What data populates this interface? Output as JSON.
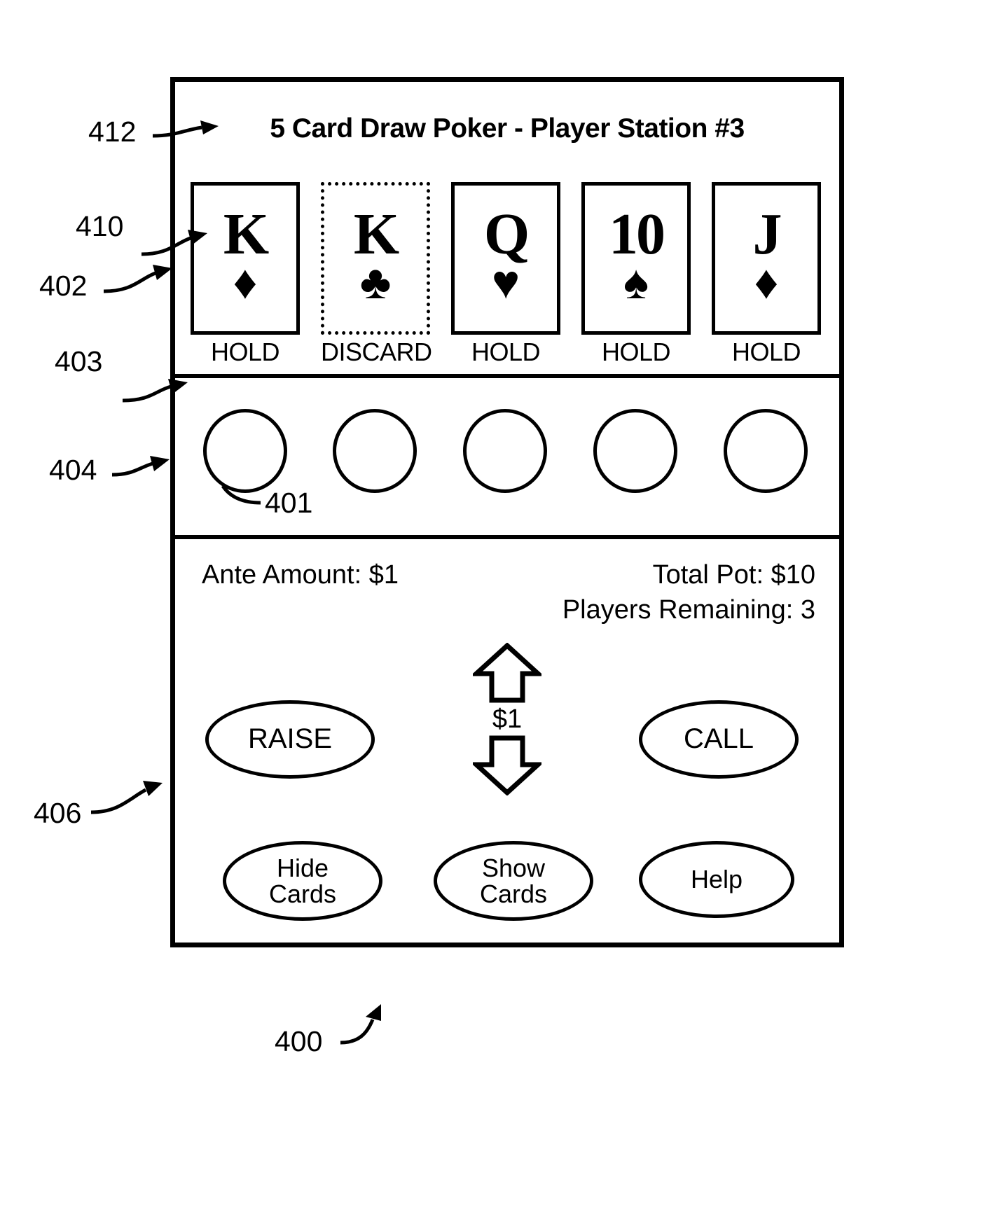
{
  "figure": {
    "number": "400",
    "title": "5 Card Draw Poker - Player Station #3"
  },
  "reference_labels": [
    {
      "id": "412",
      "text": "412"
    },
    {
      "id": "410",
      "text": "410"
    },
    {
      "id": "402",
      "text": "402"
    },
    {
      "id": "403",
      "text": "403"
    },
    {
      "id": "404",
      "text": "404"
    },
    {
      "id": "401",
      "text": "401"
    },
    {
      "id": "406",
      "text": "406"
    },
    {
      "id": "400",
      "text": "400"
    }
  ],
  "cards": [
    {
      "rank": "K",
      "suit": "diamond",
      "suit_glyph": "♦",
      "action": "HOLD",
      "selected": false
    },
    {
      "rank": "K",
      "suit": "club",
      "suit_glyph": "♣",
      "action": "DISCARD",
      "selected": true
    },
    {
      "rank": "Q",
      "suit": "heart",
      "suit_glyph": "♥",
      "action": "HOLD",
      "selected": false
    },
    {
      "rank": "10",
      "suit": "spade",
      "suit_glyph": "♠",
      "action": "HOLD",
      "selected": false
    },
    {
      "rank": "J",
      "suit": "diamond",
      "suit_glyph": "♦",
      "action": "HOLD",
      "selected": false
    }
  ],
  "tokens": [
    {
      "index": 1
    },
    {
      "index": 2
    },
    {
      "index": 3
    },
    {
      "index": 4
    },
    {
      "index": 5
    }
  ],
  "status": {
    "ante": "Ante Amount: $1",
    "total_pot": "Total Pot: $10",
    "players_remaining": "Players Remaining: 3"
  },
  "stepper": {
    "increase_icon": "arrow-up-icon",
    "decrease_icon": "arrow-down-icon",
    "bet_amount": "$1"
  },
  "buttons": {
    "raise": "RAISE",
    "call": "CALL",
    "hide_cards": "Hide\nCards",
    "hide_cards_line1": "Hide",
    "hide_cards_line2": "Cards",
    "show_cards_line1": "Show",
    "show_cards_line2": "Cards",
    "help": "Help"
  },
  "colors": {
    "ink": "#000000",
    "paper": "#ffffff"
  }
}
